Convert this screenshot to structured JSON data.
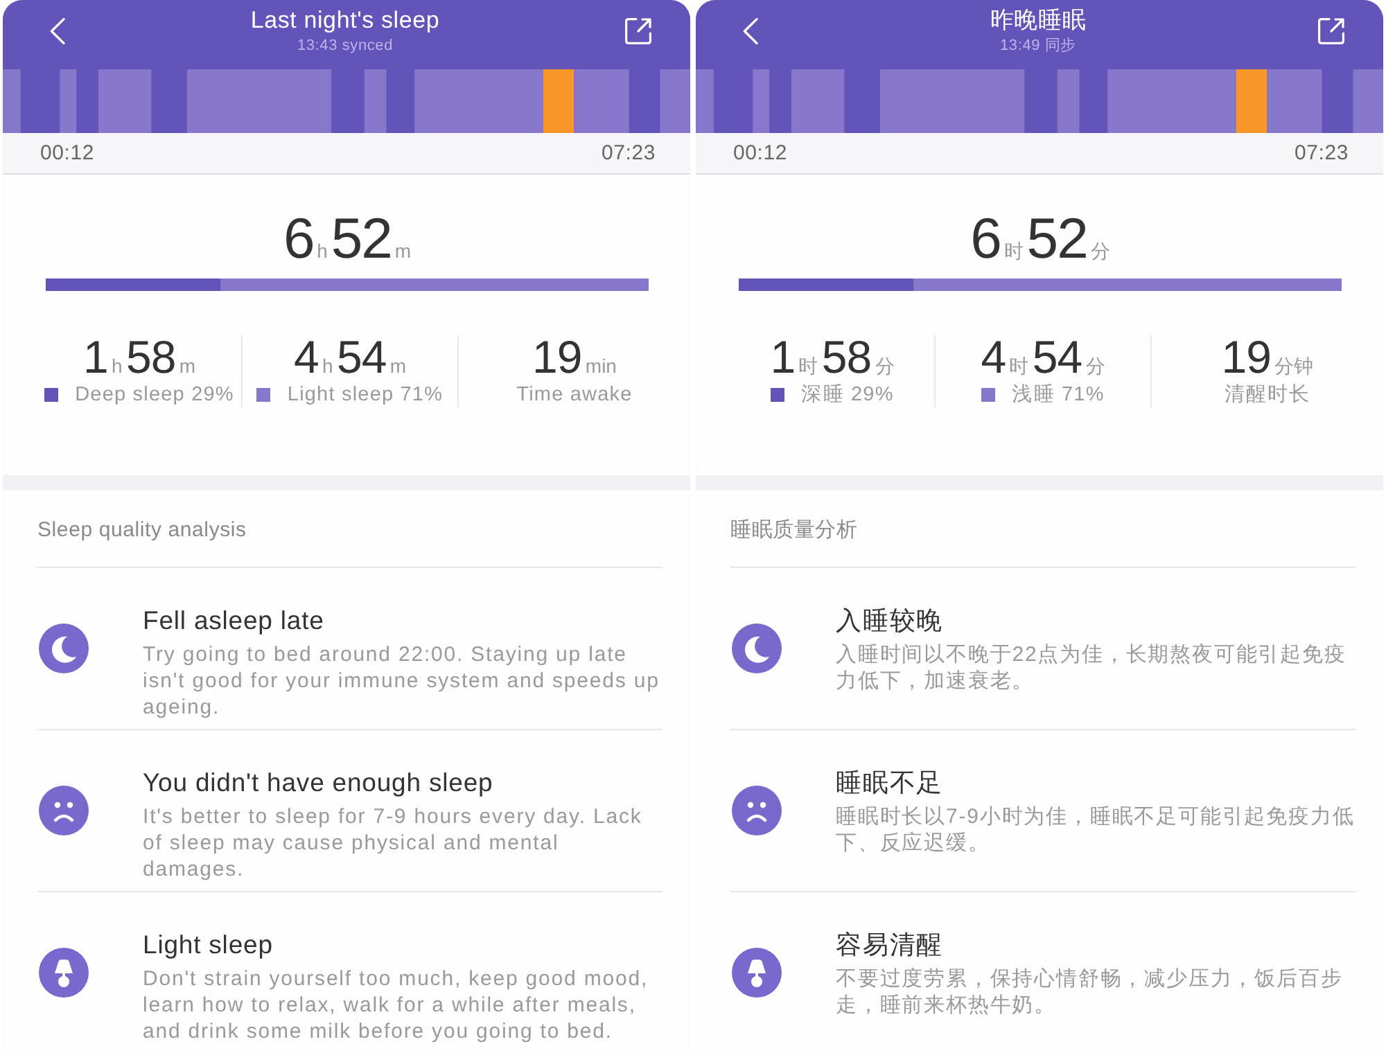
{
  "panels": [
    {
      "header": {
        "title": "Last night's sleep",
        "subtitle": "13:43 synced"
      },
      "timeline": {
        "start_time": "00:12",
        "end_time": "07:23"
      },
      "summary": {
        "total": [
          {
            "value": "6",
            "unit": "h"
          },
          {
            "value": "52",
            "unit": "m"
          }
        ],
        "ratio_bar": {
          "level": 0.29
        },
        "stats": [
          {
            "duration": [
              {
                "value": "1",
                "unit": "h"
              },
              {
                "value": "58",
                "unit": "m"
              }
            ],
            "label": "Deep sleep 29%",
            "color": "#6354b9"
          },
          {
            "duration": [
              {
                "value": "4",
                "unit": "h"
              },
              {
                "value": "54",
                "unit": "m"
              }
            ],
            "label": "Light sleep 71%",
            "color": "#8677cb"
          },
          {
            "duration": [
              {
                "value": "19",
                "unit": "min"
              }
            ],
            "label": "Time awake"
          }
        ]
      },
      "analysis": {
        "title": "Sleep quality analysis",
        "items": [
          {
            "kind": "moon",
            "title": "Fell asleep late",
            "text": "Try going to bed around 22:00. Staying up late isn't good for your immune system and speeds up ageing."
          },
          {
            "kind": "sad-face",
            "title": "You didn't have enough sleep",
            "text": "It's better to sleep for 7-9 hours every day. Lack of sleep may cause physical and mental damages."
          },
          {
            "kind": "lamp",
            "title": "Light sleep",
            "text": "Don't strain yourself too much, keep good mood, learn how to relax, walk for a while after meals, and drink some milk before you going to bed."
          }
        ]
      }
    },
    {
      "header": {
        "title": "昨晚睡眠",
        "subtitle": "13:49 同步"
      },
      "timeline": {
        "start_time": "00:12",
        "end_time": "07:23"
      },
      "summary": {
        "total": [
          {
            "value": "6",
            "unit": "时"
          },
          {
            "value": "52",
            "unit": "分"
          }
        ],
        "ratio_bar": {
          "level": 0.29
        },
        "stats": [
          {
            "duration": [
              {
                "value": "1",
                "unit": "时"
              },
              {
                "value": "58",
                "unit": "分"
              }
            ],
            "label": "深睡 29%",
            "color": "#6354b9"
          },
          {
            "duration": [
              {
                "value": "4",
                "unit": "时"
              },
              {
                "value": "54",
                "unit": "分"
              }
            ],
            "label": "浅睡 71%",
            "color": "#8677cb"
          },
          {
            "duration": [
              {
                "value": "19",
                "unit": "分钟"
              }
            ],
            "label": "清醒时长"
          }
        ]
      },
      "analysis": {
        "title": "睡眠质量分析",
        "items": [
          {
            "kind": "moon",
            "title": "入睡较晚",
            "text": "入睡时间以不晚于22点为佳，长期熬夜可能引起免疫力低下，加速衰老。"
          },
          {
            "kind": "sad-face",
            "title": "睡眠不足",
            "text": "睡眠时长以7-9小时为佳，睡眠不足可能引起免疫力低下、反应迟缓。"
          },
          {
            "kind": "lamp",
            "title": "容易清醒",
            "text": "不要过度劳累，保持心情舒畅，减少压力，饭后百步走，睡前来杯热牛奶。"
          }
        ]
      }
    }
  ]
}
